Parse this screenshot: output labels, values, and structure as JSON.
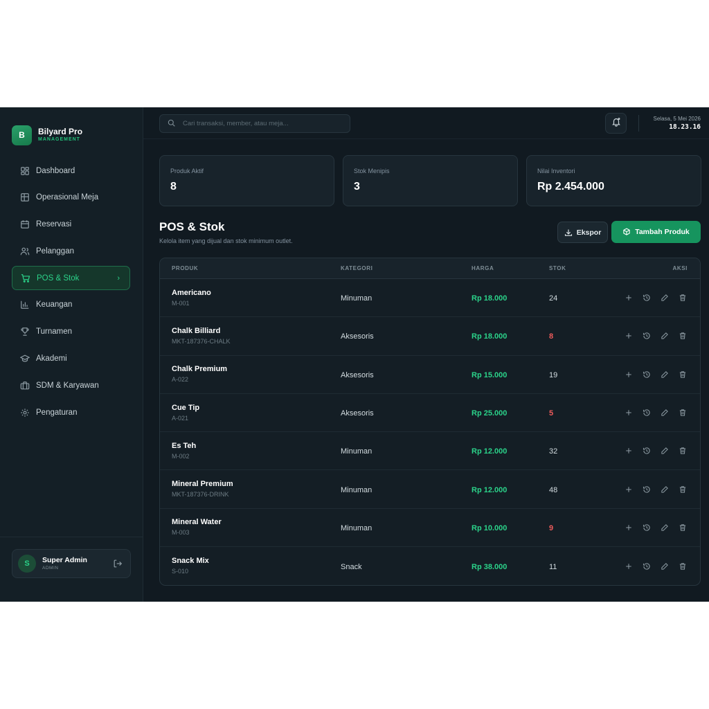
{
  "brand": {
    "name": "Bilyard Pro",
    "subtitle": "MANAGEMENT",
    "logo_letter": "B"
  },
  "sidebar": {
    "items": [
      {
        "label": "Dashboard",
        "icon": "dashboard-icon"
      },
      {
        "label": "Operasional Meja",
        "icon": "table-grid-icon"
      },
      {
        "label": "Reservasi",
        "icon": "calendar-icon"
      },
      {
        "label": "Pelanggan",
        "icon": "users-icon"
      },
      {
        "label": "POS & Stok",
        "icon": "cart-icon",
        "active": true
      },
      {
        "label": "Keuangan",
        "icon": "bar-chart-icon"
      },
      {
        "label": "Turnamen",
        "icon": "trophy-icon"
      },
      {
        "label": "Akademi",
        "icon": "graduation-cap-icon"
      },
      {
        "label": "SDM & Karyawan",
        "icon": "briefcase-icon"
      },
      {
        "label": "Pengaturan",
        "icon": "gear-icon"
      }
    ],
    "active_chevron": "›"
  },
  "user": {
    "initial": "S",
    "name": "Super Admin",
    "role": "ADMIN"
  },
  "topbar": {
    "search_placeholder": "Cari transaksi, member, atau meja...",
    "date": "Selasa, 5 Mei 2026",
    "time": "18.23.16"
  },
  "stats": [
    {
      "label": "Produk Aktif",
      "value": "8"
    },
    {
      "label": "Stok Menipis",
      "value": "3"
    },
    {
      "label": "Nilai Inventori",
      "value": "Rp 2.454.000"
    }
  ],
  "page": {
    "title": "POS & Stok",
    "subtitle": "Kelola item yang dijual dan stok minimum outlet.",
    "export_label": "Ekspor",
    "add_label": "Tambah Produk"
  },
  "table": {
    "headers": {
      "produk": "PRODUK",
      "kategori": "KATEGORI",
      "harga": "HARGA",
      "stok": "STOK",
      "aksi": "AKSI"
    },
    "rows": [
      {
        "name": "Americano",
        "sku": "M-001",
        "kategori": "Minuman",
        "harga": "Rp 18.000",
        "stok": "24",
        "low": false
      },
      {
        "name": "Chalk Billiard",
        "sku": "MKT-187376-CHALK",
        "kategori": "Aksesoris",
        "harga": "Rp 18.000",
        "stok": "8",
        "low": true
      },
      {
        "name": "Chalk Premium",
        "sku": "A-022",
        "kategori": "Aksesoris",
        "harga": "Rp 15.000",
        "stok": "19",
        "low": false
      },
      {
        "name": "Cue Tip",
        "sku": "A-021",
        "kategori": "Aksesoris",
        "harga": "Rp 25.000",
        "stok": "5",
        "low": true
      },
      {
        "name": "Es Teh",
        "sku": "M-002",
        "kategori": "Minuman",
        "harga": "Rp 12.000",
        "stok": "32",
        "low": false
      },
      {
        "name": "Mineral Premium",
        "sku": "MKT-187376-DRINK",
        "kategori": "Minuman",
        "harga": "Rp 12.000",
        "stok": "48",
        "low": false
      },
      {
        "name": "Mineral Water",
        "sku": "M-003",
        "kategori": "Minuman",
        "harga": "Rp 10.000",
        "stok": "9",
        "low": true
      },
      {
        "name": "Snack Mix",
        "sku": "S-010",
        "kategori": "Snack",
        "harga": "Rp 38.000",
        "stok": "11",
        "low": false
      }
    ]
  },
  "colors": {
    "accent": "#2bd38a",
    "primary_button": "#16945e",
    "danger": "#ef5b5b",
    "background": "#111a21"
  }
}
